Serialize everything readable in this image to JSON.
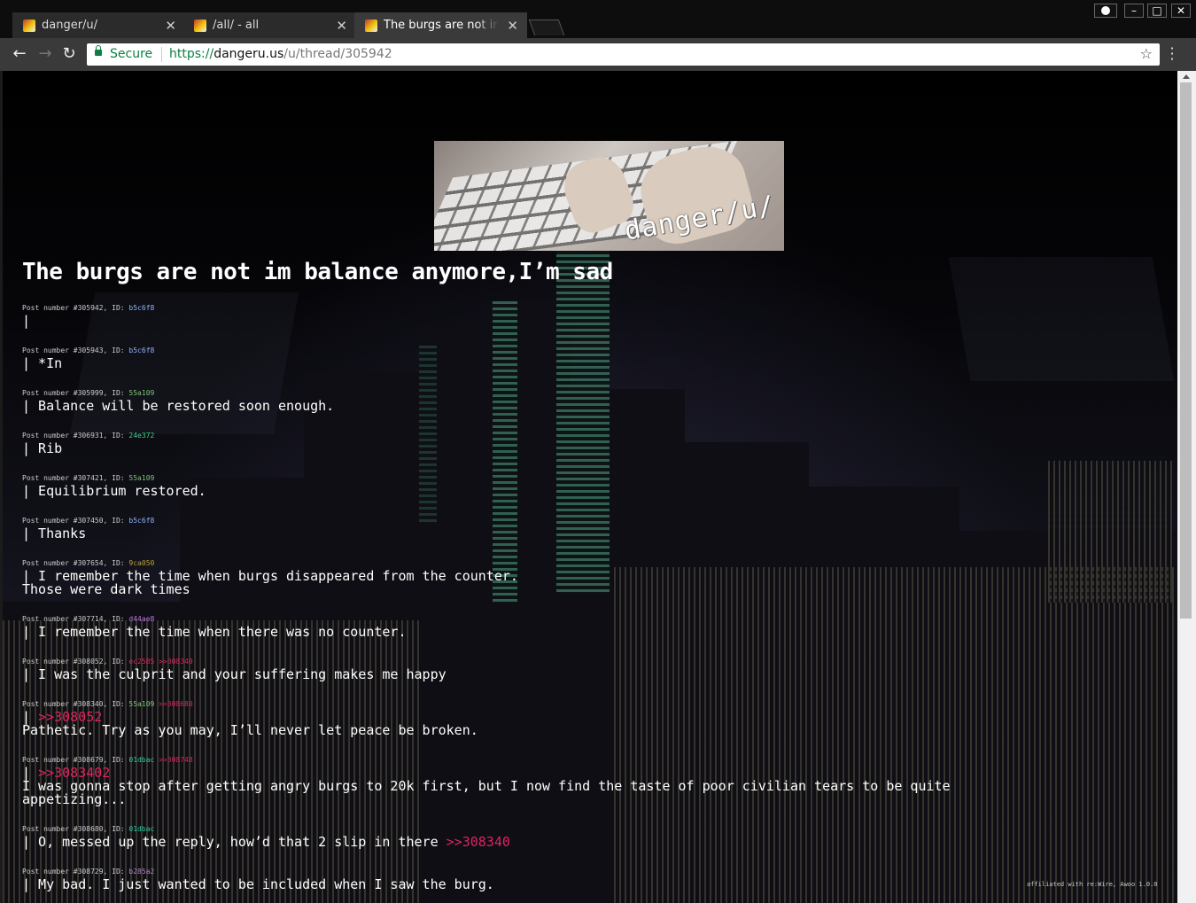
{
  "browser": {
    "tabs": [
      {
        "title": "danger/u/",
        "close": "✕"
      },
      {
        "title": "/all/ - all",
        "close": "✕"
      },
      {
        "title": "The burgs are not im balance anymore,I'm sad",
        "close": "✕"
      }
    ],
    "secure_label": "Secure",
    "url": {
      "scheme": "https://",
      "host": "dangeru.us",
      "path": "/u/thread/305942"
    }
  },
  "banner": {
    "text": "danger/u/"
  },
  "thread": {
    "title": "The burgs are not im balance anymore,I’m sad"
  },
  "posts": [
    {
      "meta": "Post number #305942, ID: ",
      "uid": "b5c6f8",
      "uid_color": "#8fb3ff",
      "reply": "",
      "lines": [
        "|"
      ]
    },
    {
      "meta": "Post number #305943, ID: ",
      "uid": "b5c6f8",
      "uid_color": "#8fb3ff",
      "reply": "",
      "lines": [
        "| *In"
      ]
    },
    {
      "meta": "Post number #305999, ID: ",
      "uid": "55a109",
      "uid_color": "#7cc576",
      "reply": "",
      "lines": [
        "| Balance will be restored soon enough."
      ]
    },
    {
      "meta": "Post number #306931, ID: ",
      "uid": "24e372",
      "uid_color": "#3fd38a",
      "reply": "",
      "lines": [
        "| Rib"
      ]
    },
    {
      "meta": "Post number #307421, ID: ",
      "uid": "55a109",
      "uid_color": "#7cc576",
      "reply": "",
      "lines": [
        "| Equilibrium restored."
      ]
    },
    {
      "meta": "Post number #307450, ID: ",
      "uid": "b5c6f8",
      "uid_color": "#8fb3ff",
      "reply": "",
      "lines": [
        "| Thanks"
      ]
    },
    {
      "meta": "Post number #307654, ID: ",
      "uid": "9ca050",
      "uid_color": "#b8a23a",
      "reply": "",
      "lines": [
        "| I remember the time when burgs disappeared from the counter.",
        "Those were dark times"
      ]
    },
    {
      "meta": "Post number #307714, ID: ",
      "uid": "d44ae8",
      "uid_color": "#c07be0",
      "reply": "",
      "lines": [
        "| I remember the time when there was no counter."
      ]
    },
    {
      "meta": "Post number #308052, ID: ",
      "uid": "ec2585",
      "uid_color": "#e0245e",
      "reply": " >>308340",
      "lines": [
        "| I was the culprit and your suffering makes me happy"
      ]
    },
    {
      "meta": "Post number #308340, ID: ",
      "uid": "55a109",
      "uid_color": "#7cc576",
      "reply": " >>308680",
      "ref": ">>308052",
      "lines": [
        "Pathetic. Try as you may, I’ll never let peace be broken."
      ]
    },
    {
      "meta": "Post number #308679, ID: ",
      "uid": "01dbac",
      "uid_color": "#2fc7a0",
      "reply": " >>308748",
      "ref": ">>3083402",
      "lines": [
        "I was gonna stop after getting angry burgs to 20k first, but I now find the taste of poor civilian tears to be quite",
        "appetizing..."
      ]
    },
    {
      "meta": "Post number #308680, ID: ",
      "uid": "01dbac",
      "uid_color": "#2fc7a0",
      "reply": "",
      "lines": [
        "| O, messed up the reply, how’d that 2 slip in there "
      ],
      "trail_ref": ">>308340"
    },
    {
      "meta": "Post number #308729, ID: ",
      "uid": "b285a2",
      "uid_color": "#b087c8",
      "reply": "",
      "lines": [
        "| My bad. I just wanted to be included when I saw the burg."
      ]
    }
  ],
  "footer": {
    "text": "affiliated with re:Wire, Awoo 1.0.0"
  },
  "colors": {
    "reply_link": "#e0245e",
    "secure_green": "#0b8043"
  }
}
